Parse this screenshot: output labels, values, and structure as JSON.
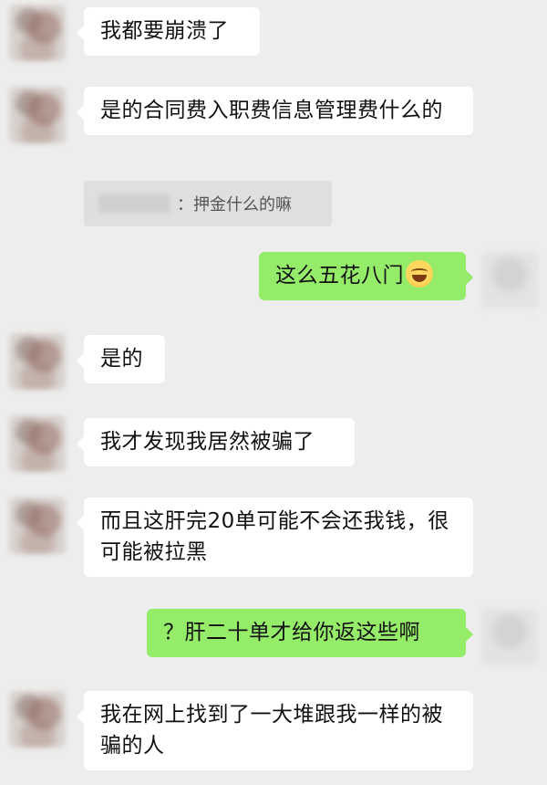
{
  "messages": [
    {
      "side": "left",
      "text": "我都要崩溃了"
    },
    {
      "side": "left",
      "text": "是的合同费入职费信息管理费什么的"
    },
    {
      "side": "left",
      "quote": {
        "text": "押金什么的嘛"
      }
    },
    {
      "side": "right",
      "text": "这么五花八门",
      "emoji": "face-with-tears-of-joy"
    },
    {
      "side": "left",
      "text": "是的"
    },
    {
      "side": "left",
      "text": "我才发现我居然被骗了"
    },
    {
      "side": "left",
      "text": "而且这肝完20单可能不会还我钱，很可能被拉黑"
    },
    {
      "side": "right",
      "text": "？肝二十单才给你返这些啊"
    },
    {
      "side": "left",
      "text": "我在网上找到了一大堆跟我一样的被骗的人"
    }
  ],
  "colors": {
    "background": "#ededed",
    "incoming_bubble": "#ffffff",
    "outgoing_bubble": "#95ec69",
    "quote_background": "#dfdfdf"
  }
}
